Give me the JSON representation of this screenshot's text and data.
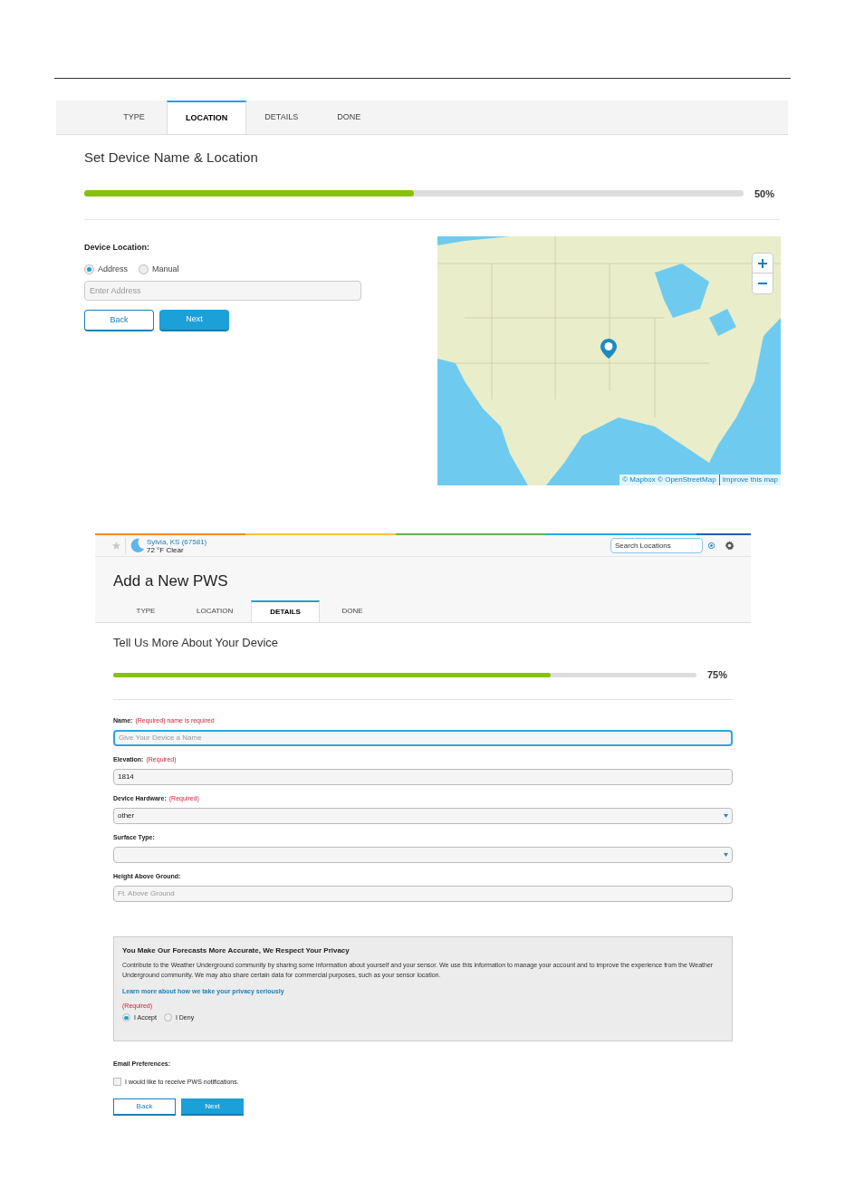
{
  "location_step": {
    "tabs": [
      {
        "label": "TYPE",
        "selected": false
      },
      {
        "label": "LOCATION",
        "selected": true
      },
      {
        "label": "DETAILS",
        "selected": false
      },
      {
        "label": "DONE",
        "selected": false
      }
    ],
    "heading": "Set Device Name & Location",
    "progress": {
      "level": 0.5,
      "reading": "50%"
    },
    "field_label": "Device Location:",
    "radios": [
      {
        "label": "Address",
        "selected": true
      },
      {
        "label": "Manual",
        "selected": false
      }
    ],
    "address": {
      "placeholder": "Enter Address"
    },
    "buttons": [
      {
        "label": "Back",
        "kind": "secondary"
      },
      {
        "label": "Next",
        "kind": "primary"
      }
    ],
    "map": {
      "attribution": "© Mapbox © OpenStreetMap",
      "link": "Improve this map"
    }
  },
  "details_step": {
    "location": {
      "place": "Sylvia, KS (67581)",
      "weather": "72 °F Clear"
    },
    "search": {
      "placeholder": "Search Locations"
    },
    "title": "Add a New PWS",
    "tabs": [
      {
        "label": "TYPE",
        "selected": false
      },
      {
        "label": "LOCATION",
        "selected": false
      },
      {
        "label": "DETAILS",
        "selected": true
      },
      {
        "label": "DONE",
        "selected": false
      }
    ],
    "heading": "Tell Us More About Your Device",
    "progress": {
      "level": 0.75,
      "reading": "75%"
    },
    "fields": [
      {
        "label": "Name:",
        "note": "(Required) name is required",
        "kind": "text",
        "placeholder": "Give Your Device a Name",
        "focused": true
      },
      {
        "label": "Elevation:",
        "note": "(Required)",
        "kind": "text",
        "value": "1814",
        "focused": false
      },
      {
        "label": "Device Hardware:",
        "note": "(Required)",
        "kind": "select",
        "value": "other",
        "focused": false
      },
      {
        "label": "Surface Type:",
        "kind": "select",
        "focused": false
      },
      {
        "label": "Height Above Ground:",
        "kind": "text",
        "placeholder": "Ft. Above Ground",
        "focused": false
      }
    ],
    "privacy": {
      "title": "You Make Our Forecasts More Accurate, We Respect Your Privacy",
      "body": "Contribute to the Weather Underground community by sharing some information about yourself and your sensor. We use this information to manage your account and to improve the experience from the Weather Underground community. We may also share certain data for commercial purposes, such as your sensor location.",
      "link": "Learn more about how we take your privacy seriously",
      "required": "(Required)",
      "radios": [
        {
          "label": "I Accept",
          "selected": true
        },
        {
          "label": "I Deny",
          "selected": false
        }
      ]
    },
    "email": {
      "label": "Email Preferences:",
      "option": "I would like to receive PWS notifications.",
      "checked": false
    },
    "buttons": [
      {
        "label": "Back",
        "kind": "secondary"
      },
      {
        "label": "Next",
        "kind": "primary"
      }
    ]
  }
}
